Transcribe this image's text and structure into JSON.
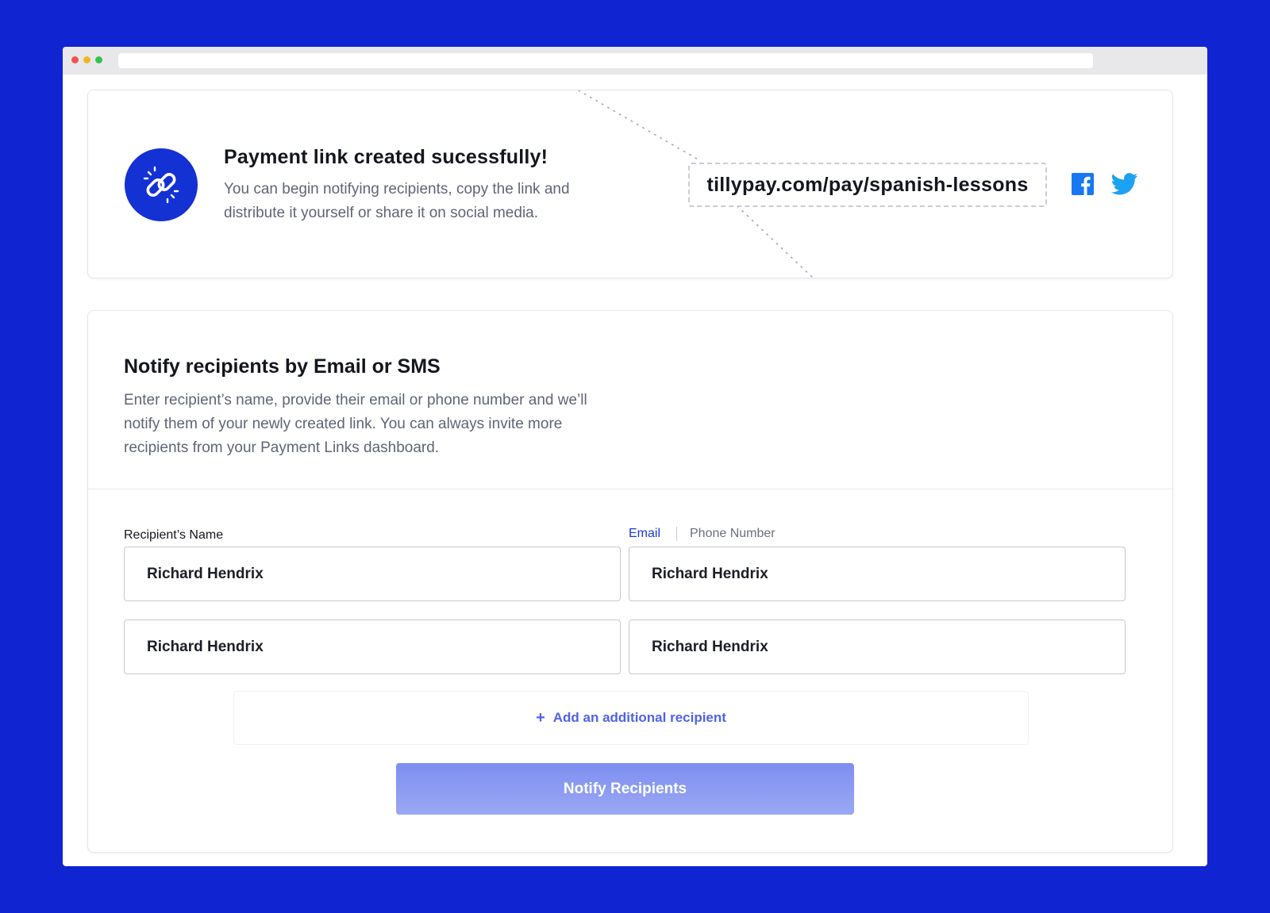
{
  "success": {
    "title": "Payment link created sucessfully!",
    "description": "You can begin notifying recipients, copy the link and distribute it yourself or share it on social media.",
    "link": "tillypay.com/pay/spanish-lessons",
    "icons": [
      "link-icon",
      "facebook-icon",
      "twitter-icon"
    ]
  },
  "notify": {
    "title": "Notify recipients by Email or SMS",
    "description": "Enter recipient’s name, provide their email or phone number and we’ll notify them of your newly created link. You can always invite more recipients from your Payment Links dashboard.",
    "name_label": "Recipient’s Name",
    "toggle_email": "Email",
    "toggle_phone": "Phone Number",
    "rows": [
      {
        "name": "Richard Hendrix",
        "contact": "Richard Hendrix"
      },
      {
        "name": "Richard Hendrix",
        "contact": "Richard Hendrix"
      }
    ],
    "add_label": "Add an additional recipient",
    "add_symbol": "+",
    "submit_label": "Notify Recipients"
  },
  "colors": {
    "background": "#1024d1",
    "accent": "#1431d4",
    "facebook": "#1877f2",
    "twitter": "#1da1f2",
    "button": "#8a99f1"
  }
}
